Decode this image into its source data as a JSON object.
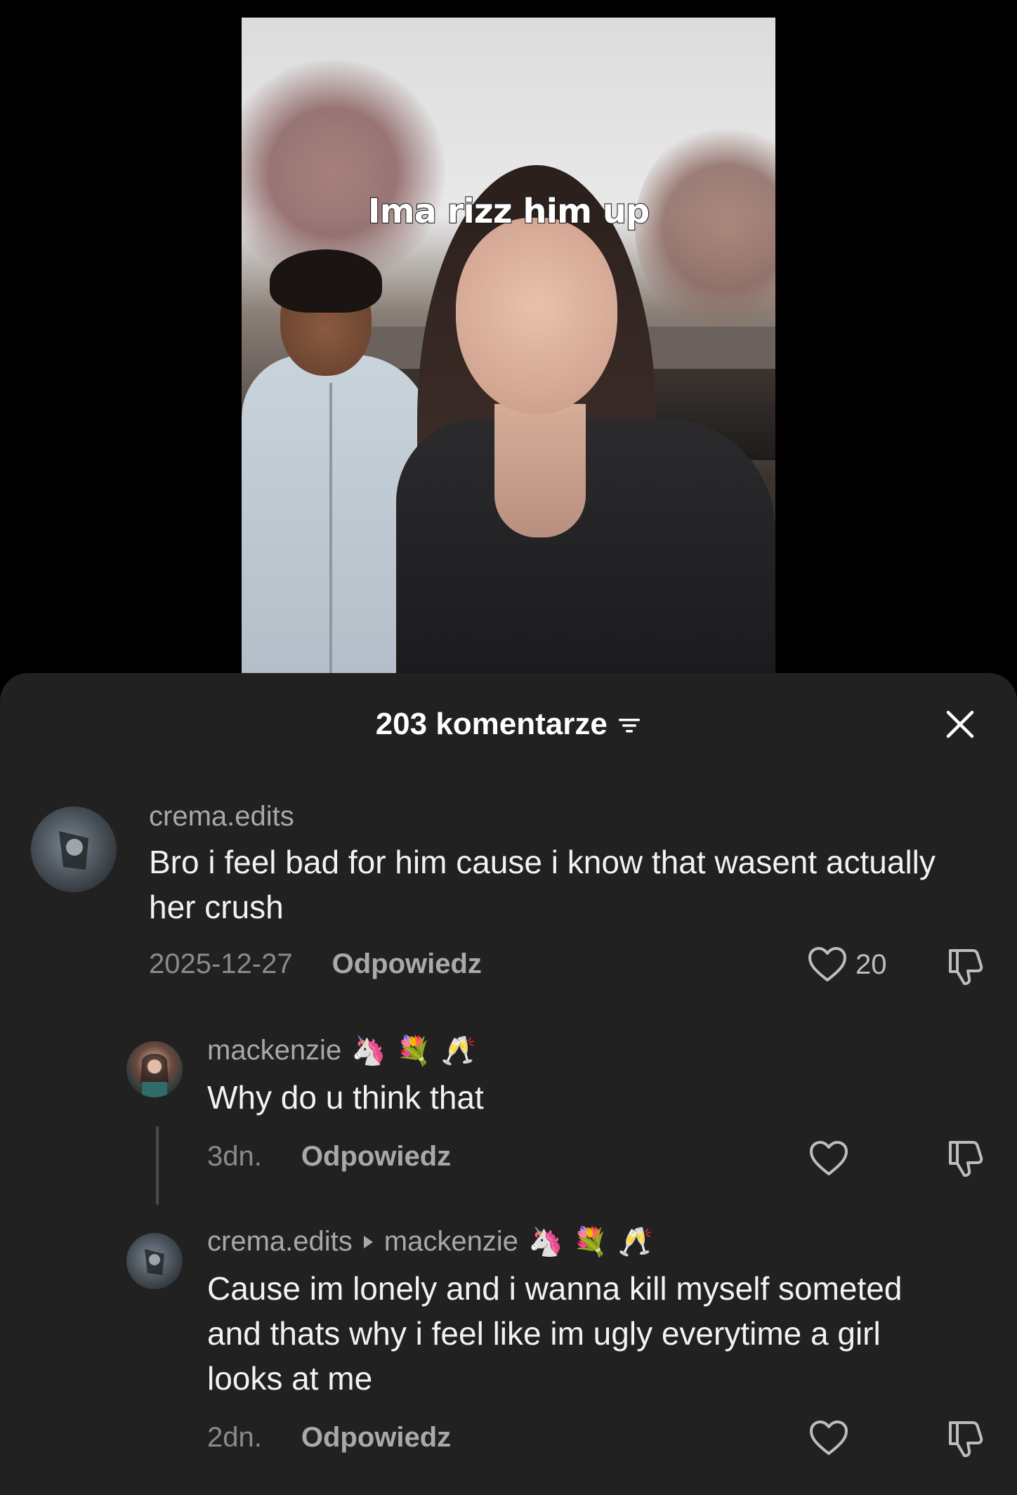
{
  "video": {
    "caption": "Ima rizz him up"
  },
  "comments_panel": {
    "title": "203 komentarze",
    "comments": [
      {
        "username": "crema.edits",
        "text": "Bro i feel bad for him cause i know that wasent actually her crush",
        "date": "2025-12-27",
        "reply_label": "Odpowiedz",
        "likes": "20"
      },
      {
        "username": "mackenzie",
        "emojis": [
          "🦄",
          "💐",
          "🥂"
        ],
        "text": "Why do u think that",
        "date": "3dn.",
        "reply_label": "Odpowiedz"
      },
      {
        "username": "crema.edits",
        "reply_to": "mackenzie",
        "emojis": [
          "🦄",
          "💐",
          "🥂"
        ],
        "text": "Cause im lonely and i wanna kill myself someted and thats why i feel like im ugly everytime a girl looks at me",
        "date": "2dn.",
        "reply_label": "Odpowiedz"
      }
    ]
  },
  "icons": [
    "filter-icon",
    "close-icon",
    "heart-icon",
    "dislike-icon"
  ],
  "colors": {
    "background": "#000000",
    "sheet": "#212121",
    "username": "#a8a8a8",
    "text": "#f2f2f2",
    "secondary": "#8a8a8a"
  }
}
